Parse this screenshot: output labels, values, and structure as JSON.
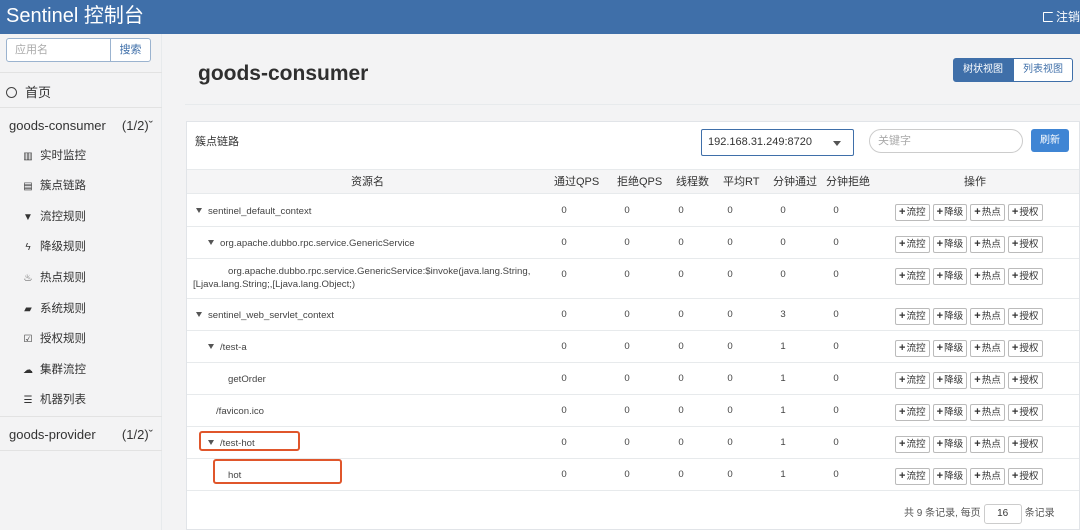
{
  "header": {
    "title": "Sentinel 控制台",
    "logout_label": "注销"
  },
  "sidebar": {
    "search_placeholder": "应用名",
    "search_button": "搜索",
    "home_label": "首页",
    "apps": [
      {
        "name": "goods-consumer",
        "count": "(1/2)"
      },
      {
        "name": "goods-provider",
        "count": "(1/2)"
      }
    ],
    "menu": [
      {
        "icon": "bar-chart-icon",
        "glyph": "▥",
        "label": "实时监控"
      },
      {
        "icon": "list-icon",
        "glyph": "▤",
        "label": "簇点链路"
      },
      {
        "icon": "filter-icon",
        "glyph": "▼",
        "label": "流控规则"
      },
      {
        "icon": "bolt-icon",
        "glyph": "ϟ",
        "label": "降级规则"
      },
      {
        "icon": "fire-icon",
        "glyph": "♨",
        "label": "热点规则"
      },
      {
        "icon": "lock-icon",
        "glyph": "▰",
        "label": "系统规则"
      },
      {
        "icon": "check-square-icon",
        "glyph": "☑",
        "label": "授权规则"
      },
      {
        "icon": "cloud-icon",
        "glyph": "☁",
        "label": "集群流控"
      },
      {
        "icon": "th-list-icon",
        "glyph": "☰",
        "label": "机器列表"
      }
    ]
  },
  "main": {
    "title": "goods-consumer",
    "view_tree": "树状视图",
    "view_list": "列表视图",
    "panel_title": "簇点链路",
    "ip_selected": "192.168.31.249:8720",
    "keyword_placeholder": "关键字",
    "refresh_button": "刷新"
  },
  "table": {
    "headers": [
      "资源名",
      "通过QPS",
      "拒绝QPS",
      "线程数",
      "平均RT",
      "分钟通过",
      "分钟拒绝",
      "操作"
    ],
    "op_labels": [
      "流控",
      "降级",
      "热点",
      "授权"
    ],
    "rows": [
      {
        "name": "sentinel_default_context",
        "has_children": true,
        "pass_qps": "0",
        "block_qps": "0",
        "threads": "0",
        "avg_rt": "0",
        "min_pass": "0",
        "min_block": "0"
      },
      {
        "name": "org.apache.dubbo.rpc.service.GenericService",
        "has_children": true,
        "pass_qps": "0",
        "block_qps": "0",
        "threads": "0",
        "avg_rt": "0",
        "min_pass": "0",
        "min_block": "0"
      },
      {
        "name": "org.apache.dubbo.rpc.service.GenericService:$invoke(java.lang.String,[Ljava.lang.String;,[Ljava.lang.Object;)",
        "has_children": false,
        "pass_qps": "0",
        "block_qps": "0",
        "threads": "0",
        "avg_rt": "0",
        "min_pass": "0",
        "min_block": "0"
      },
      {
        "name": "sentinel_web_servlet_context",
        "has_children": true,
        "pass_qps": "0",
        "block_qps": "0",
        "threads": "0",
        "avg_rt": "0",
        "min_pass": "3",
        "min_block": "0"
      },
      {
        "name": "/test-a",
        "has_children": true,
        "pass_qps": "0",
        "block_qps": "0",
        "threads": "0",
        "avg_rt": "0",
        "min_pass": "1",
        "min_block": "0"
      },
      {
        "name": "getOrder",
        "has_children": false,
        "pass_qps": "0",
        "block_qps": "0",
        "threads": "0",
        "avg_rt": "0",
        "min_pass": "1",
        "min_block": "0"
      },
      {
        "name": "/favicon.ico",
        "has_children": false,
        "pass_qps": "0",
        "block_qps": "0",
        "threads": "0",
        "avg_rt": "0",
        "min_pass": "1",
        "min_block": "0"
      },
      {
        "name": "/test-hot",
        "has_children": true,
        "pass_qps": "0",
        "block_qps": "0",
        "threads": "0",
        "avg_rt": "0",
        "min_pass": "1",
        "min_block": "0"
      },
      {
        "name": "hot",
        "has_children": false,
        "pass_qps": "0",
        "block_qps": "0",
        "threads": "0",
        "avg_rt": "0",
        "min_pass": "1",
        "min_block": "0"
      }
    ]
  },
  "pagination": {
    "prefix": "共 9 条记录, 每页",
    "page_size": "16",
    "suffix": "条记录"
  },
  "colors": {
    "header_bg": "#3f6fa9",
    "accent": "#3f85d4",
    "highlight": "#e0562b"
  }
}
